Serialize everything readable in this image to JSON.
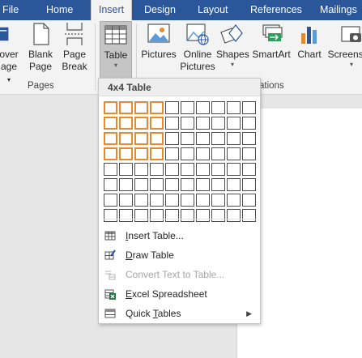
{
  "tabs": {
    "file": "File",
    "home": "Home",
    "insert": "Insert",
    "design": "Design",
    "layout": "Layout",
    "references": "References",
    "mailings": "Mailings"
  },
  "ribbon": {
    "cover_page": {
      "line1": "over",
      "line2": "age"
    },
    "blank_page": {
      "line1": "Blank",
      "line2": "Page"
    },
    "page_break": {
      "line1": "Page",
      "line2": "Break"
    },
    "table": {
      "label": "Table"
    },
    "pictures": {
      "line1": "Pictures"
    },
    "online_pictures": {
      "line1": "Online",
      "line2": "Pictures"
    },
    "shapes": {
      "line1": "Shapes"
    },
    "smartart": {
      "line1": "SmartArt"
    },
    "chart": {
      "line1": "Chart"
    },
    "screenshot": {
      "line1": "Screensh"
    },
    "groups": {
      "pages": "Pages",
      "illustrations": "ations"
    }
  },
  "table_menu": {
    "header": "4x4 Table",
    "grid_cols": 10,
    "grid_rows": 8,
    "selected_cols": 4,
    "selected_rows": 4,
    "items": [
      {
        "label": "Insert Table...",
        "mnemonic": "I",
        "rest": "nsert Table...",
        "icon": "insert-table-icon",
        "enabled": true
      },
      {
        "label": "Draw Table",
        "mnemonic": "D",
        "rest": "raw Table",
        "icon": "draw-table-icon",
        "enabled": true
      },
      {
        "label": "Convert Text to Table...",
        "mnemonic": "",
        "rest": "Convert Text to Table...",
        "icon": "convert-text-icon",
        "enabled": false
      },
      {
        "label": "Excel Spreadsheet",
        "mnemonic": "E",
        "rest": "xcel Spreadsheet",
        "icon": "excel-icon",
        "enabled": true
      },
      {
        "label": "Quick Tables",
        "mnemonic": "",
        "rest": "Quick ",
        "mnemonic2": "T",
        "rest2": "ables",
        "icon": "quick-tables-icon",
        "enabled": true
      }
    ]
  },
  "colors": {
    "ribbon_blue": "#2b579a",
    "selection_orange": "#e58a2e"
  }
}
